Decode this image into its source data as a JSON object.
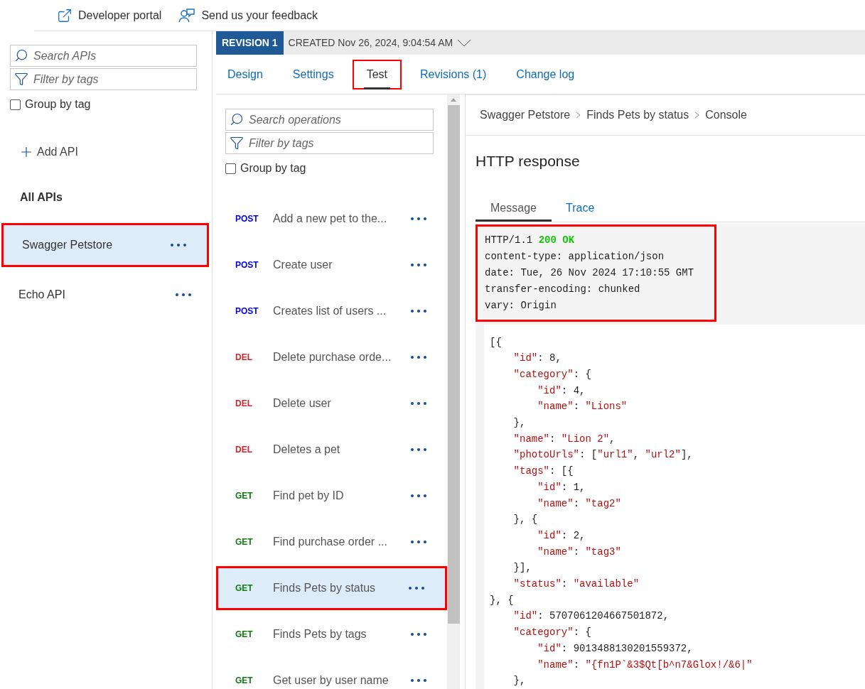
{
  "top_links": [
    {
      "kind": "portal",
      "label": "Developer portal"
    },
    {
      "kind": "feedback",
      "label": "Send us your feedback"
    }
  ],
  "sidebar": {
    "search": {
      "placeholder": "Search APIs"
    },
    "filter": {
      "placeholder": "Filter by tags"
    },
    "group_by_tag": {
      "label": "Group by tag",
      "checked": false
    },
    "add_api": "Add API",
    "heading": "All APIs",
    "apis": [
      {
        "name": "Swagger Petstore",
        "selected": true,
        "highlighted": true
      },
      {
        "name": "Echo API",
        "selected": false,
        "highlighted": false
      }
    ]
  },
  "revision": {
    "badge": "REVISION 1",
    "created": "CREATED Nov 26, 2024, 9:04:54 AM"
  },
  "tabs": [
    {
      "label": "Design",
      "selected": false,
      "highlighted": false
    },
    {
      "label": "Settings",
      "selected": false,
      "highlighted": false
    },
    {
      "label": "Test",
      "selected": true,
      "highlighted": true
    },
    {
      "label": "Revisions (1)",
      "selected": false,
      "highlighted": false
    },
    {
      "label": "Change log",
      "selected": false,
      "highlighted": false
    }
  ],
  "operations": {
    "search": {
      "placeholder": "Search operations"
    },
    "filter": {
      "placeholder": "Filter by tags"
    },
    "group_by_tag": {
      "label": "Group by tag",
      "checked": false
    },
    "items": [
      {
        "method": "POST",
        "kind": "post",
        "name": "Add a new pet to the...",
        "selected": false,
        "highlighted": false
      },
      {
        "method": "POST",
        "kind": "post",
        "name": "Create user",
        "selected": false,
        "highlighted": false
      },
      {
        "method": "POST",
        "kind": "post",
        "name": "Creates list of users ...",
        "selected": false,
        "highlighted": false
      },
      {
        "method": "DEL",
        "kind": "delete",
        "name": "Delete purchase orde...",
        "selected": false,
        "highlighted": false
      },
      {
        "method": "DEL",
        "kind": "delete",
        "name": "Delete user",
        "selected": false,
        "highlighted": false
      },
      {
        "method": "DEL",
        "kind": "delete",
        "name": "Deletes a pet",
        "selected": false,
        "highlighted": false
      },
      {
        "method": "GET",
        "kind": "get",
        "name": "Find pet by ID",
        "selected": false,
        "highlighted": false
      },
      {
        "method": "GET",
        "kind": "get",
        "name": "Find purchase order ...",
        "selected": false,
        "highlighted": false
      },
      {
        "method": "GET",
        "kind": "get",
        "name": "Finds Pets by status",
        "selected": true,
        "highlighted": true
      },
      {
        "method": "GET",
        "kind": "get",
        "name": "Finds Pets by tags",
        "selected": false,
        "highlighted": false
      },
      {
        "method": "GET",
        "kind": "get",
        "name": "Get user by user name",
        "selected": false,
        "highlighted": false
      }
    ]
  },
  "breadcrumb": [
    "Swagger Petstore",
    "Finds Pets by status",
    "Console"
  ],
  "response": {
    "title": "HTTP response",
    "tabs": [
      {
        "label": "Message",
        "selected": true
      },
      {
        "label": "Trace",
        "selected": false
      }
    ],
    "headers": {
      "highlighted": true,
      "lines": [
        [
          {
            "kind": "plain",
            "text": "HTTP/1.1 "
          },
          {
            "kind": "status",
            "text": "200 OK"
          }
        ],
        [
          {
            "kind": "plain",
            "text": "content-type: application/json"
          }
        ],
        [
          {
            "kind": "plain",
            "text": "date: Tue, 26 Nov 2024 17:10:55 GMT"
          }
        ],
        [
          {
            "kind": "plain",
            "text": "transfer-encoding: chunked"
          }
        ],
        [
          {
            "kind": "plain",
            "text": "vary: Origin"
          }
        ]
      ]
    },
    "body": [
      [
        {
          "kind": "plain",
          "text": "[{"
        }
      ],
      [
        {
          "kind": "string",
          "text": "    \"id\""
        },
        {
          "kind": "plain",
          "text": ": 8,"
        }
      ],
      [
        {
          "kind": "string",
          "text": "    \"category\""
        },
        {
          "kind": "plain",
          "text": ": {"
        }
      ],
      [
        {
          "kind": "string",
          "text": "        \"id\""
        },
        {
          "kind": "plain",
          "text": ": 4,"
        }
      ],
      [
        {
          "kind": "string",
          "text": "        \"name\""
        },
        {
          "kind": "plain",
          "text": ": "
        },
        {
          "kind": "string",
          "text": "\"Lions\""
        }
      ],
      [
        {
          "kind": "plain",
          "text": "    },"
        }
      ],
      [
        {
          "kind": "string",
          "text": "    \"name\""
        },
        {
          "kind": "plain",
          "text": ": "
        },
        {
          "kind": "string",
          "text": "\"Lion 2\""
        },
        {
          "kind": "plain",
          "text": ","
        }
      ],
      [
        {
          "kind": "string",
          "text": "    \"photoUrls\""
        },
        {
          "kind": "plain",
          "text": ": ["
        },
        {
          "kind": "string",
          "text": "\"url1\""
        },
        {
          "kind": "plain",
          "text": ", "
        },
        {
          "kind": "string",
          "text": "\"url2\""
        },
        {
          "kind": "plain",
          "text": "],"
        }
      ],
      [
        {
          "kind": "string",
          "text": "    \"tags\""
        },
        {
          "kind": "plain",
          "text": ": [{"
        }
      ],
      [
        {
          "kind": "string",
          "text": "        \"id\""
        },
        {
          "kind": "plain",
          "text": ": 1,"
        }
      ],
      [
        {
          "kind": "string",
          "text": "        \"name\""
        },
        {
          "kind": "plain",
          "text": ": "
        },
        {
          "kind": "string",
          "text": "\"tag2\""
        }
      ],
      [
        {
          "kind": "plain",
          "text": "    }, {"
        }
      ],
      [
        {
          "kind": "string",
          "text": "        \"id\""
        },
        {
          "kind": "plain",
          "text": ": 2,"
        }
      ],
      [
        {
          "kind": "string",
          "text": "        \"name\""
        },
        {
          "kind": "plain",
          "text": ": "
        },
        {
          "kind": "string",
          "text": "\"tag3\""
        }
      ],
      [
        {
          "kind": "plain",
          "text": "    }],"
        }
      ],
      [
        {
          "kind": "string",
          "text": "    \"status\""
        },
        {
          "kind": "plain",
          "text": ": "
        },
        {
          "kind": "string",
          "text": "\"available\""
        }
      ],
      [
        {
          "kind": "plain",
          "text": "}, {"
        }
      ],
      [
        {
          "kind": "string",
          "text": "    \"id\""
        },
        {
          "kind": "plain",
          "text": ": 5707061204667501872,"
        }
      ],
      [
        {
          "kind": "string",
          "text": "    \"category\""
        },
        {
          "kind": "plain",
          "text": ": {"
        }
      ],
      [
        {
          "kind": "string",
          "text": "        \"id\""
        },
        {
          "kind": "plain",
          "text": ": 9013488130201559372,"
        }
      ],
      [
        {
          "kind": "string",
          "text": "        \"name\""
        },
        {
          "kind": "plain",
          "text": ": "
        },
        {
          "kind": "string",
          "text": "\"{fn1P`&3$Qt[b^n7&Glox!/&6|\""
        }
      ],
      [
        {
          "kind": "plain",
          "text": "    },"
        }
      ]
    ]
  }
}
